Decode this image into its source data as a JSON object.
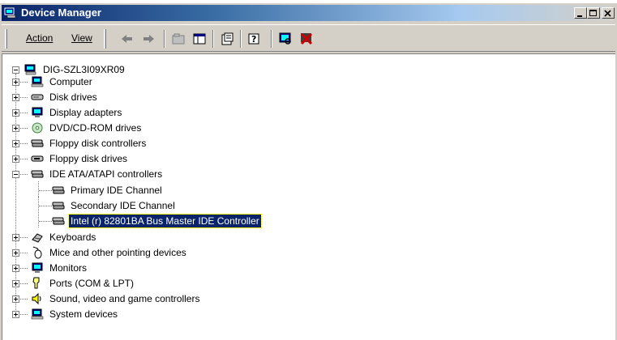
{
  "window": {
    "title": "Device Manager",
    "controls": [
      "minimize",
      "maximize",
      "close"
    ]
  },
  "menu": [
    {
      "label": "Action"
    },
    {
      "label": "View"
    }
  ],
  "toolbar": {
    "buttons": [
      "back-icon",
      "forward-icon",
      "up-level-icon",
      "show-hide-tree-icon",
      "properties-icon",
      "help-icon",
      "scan-hardware-icon",
      "uninstall-icon"
    ]
  },
  "tree": {
    "root": "DIG-SZL3I09XR09",
    "items": [
      {
        "label": "Computer",
        "icon": "computer-icon",
        "expanded": false
      },
      {
        "label": "Disk drives",
        "icon": "disk-drive-icon",
        "expanded": false
      },
      {
        "label": "Display adapters",
        "icon": "monitor-icon",
        "expanded": false
      },
      {
        "label": "DVD/CD-ROM drives",
        "icon": "cdrom-icon",
        "expanded": false
      },
      {
        "label": "Floppy disk controllers",
        "icon": "controller-icon",
        "expanded": false
      },
      {
        "label": "Floppy disk drives",
        "icon": "floppy-drive-icon",
        "expanded": false
      },
      {
        "label": "IDE ATA/ATAPI controllers",
        "icon": "controller-icon",
        "expanded": true,
        "children": [
          {
            "label": "Primary IDE Channel"
          },
          {
            "label": "Secondary IDE Channel"
          },
          {
            "label": "Intel (r) 82801BA Bus Master IDE Controller",
            "selected": true
          }
        ]
      },
      {
        "label": "Keyboards",
        "icon": "keyboard-icon",
        "expanded": false
      },
      {
        "label": "Mice and other pointing devices",
        "icon": "mouse-icon",
        "expanded": false
      },
      {
        "label": "Monitors",
        "icon": "monitor-icon",
        "expanded": false
      },
      {
        "label": "Ports (COM & LPT)",
        "icon": "port-icon",
        "expanded": false
      },
      {
        "label": "Sound, video and game controllers",
        "icon": "speaker-icon",
        "expanded": false
      },
      {
        "label": "System devices",
        "icon": "computer-icon",
        "expanded": false
      }
    ]
  },
  "colors": {
    "selection": "#0a246a",
    "titlebar_start": "#0a246a",
    "face": "#d4d0c8"
  }
}
